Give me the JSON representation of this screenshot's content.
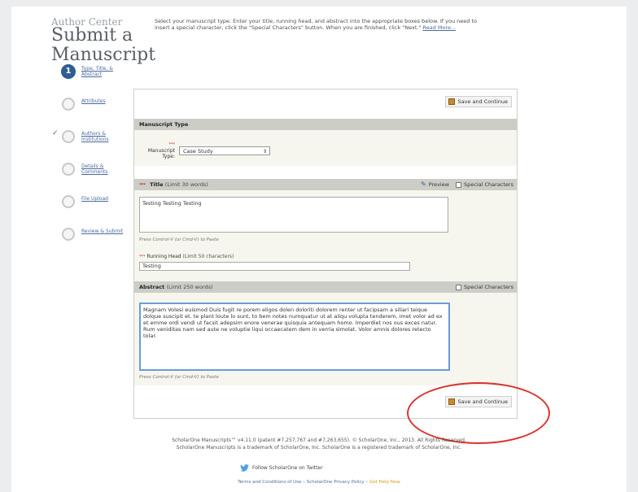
{
  "header": {
    "eyebrow": "Author Center",
    "title": "Submit a Manuscript",
    "instructions": "Select your manuscript type. Enter your title, running head, and abstract into the appropriate boxes below. If you need to insert a special character, click the \"Special Characters\" button. When you are finished, click \"Next.\"",
    "read_more": "Read More..."
  },
  "nav": [
    {
      "number": "1",
      "label": "Type, Title, & Abstract",
      "active": true
    },
    {
      "label": "Attributes"
    },
    {
      "label": "Authors & Institutions",
      "checked": true
    },
    {
      "label": "Details & Comments"
    },
    {
      "label": "File Upload"
    },
    {
      "label": "Review & Submit"
    }
  ],
  "buttons": {
    "save_continue": "Save and Continue"
  },
  "manuscript_type": {
    "heading": "Manuscript Type",
    "required_mark": "***",
    "label": "Manuscript Type:",
    "selected": "Case Study"
  },
  "title_section": {
    "required_mark": "***",
    "heading": "Title",
    "limit": "(Limit 30 words)",
    "preview": "Preview",
    "special_characters": "Special Characters",
    "value": "Testing Testing Testing",
    "hint": "Press Control-V (or Cmd-V) to Paste"
  },
  "running_head": {
    "required_mark": "***",
    "label": "Running Head",
    "limit": "(Limit 50 characters)",
    "value": "Testing"
  },
  "abstract_section": {
    "heading": "Abstract",
    "limit": "(Limit 250 words)",
    "special_characters": "Special Characters",
    "value": "Magnam Volesi euismod Duis fugit re porem eligos dolen doloriti dolorem renter ut facipsam a siliari teique dolque suscipit et. te plant loute lo sunt, to bem notes numquatur ut at aliqu volupta tenderem, imet volor ad ex et emme ordi vendi ut facsit adepsim enore venerae quisquia antequam homo. Imperdiet nos ous exces natur. Rum veniditas nam sed aute ne voluptie liqui occaecatem dem in verria simolat. Volor amnis dolores retecto tolar.",
    "hint": "Press Control-V (or Cmd-V) to Paste"
  },
  "footer": {
    "copyright": "ScholarOne Manuscripts™ v4.11.0 (patent #7,257,767 and #7,263,655). © ScholarOne, Inc., 2013. All Rights Reserved.",
    "trademark": "ScholarOne Manuscripts is a trademark of ScholarOne, Inc. ScholarOne is a registered trademark of ScholarOne, Inc.",
    "twitter": "Follow ScholarOne on Twitter",
    "terms": "Terms and Conditions of Use",
    "privacy": "ScholarOne Privacy Policy",
    "help": "Get Help Now"
  },
  "colors": {
    "accent": "#2f5d95",
    "annotation": "#d9332b",
    "section_header": "#cdcdc8"
  }
}
